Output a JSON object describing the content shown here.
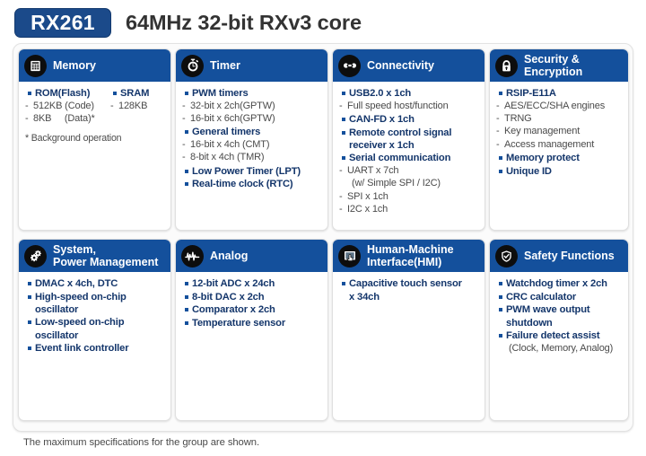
{
  "header": {
    "chip_badge": "RX261",
    "title": "64MHz 32-bit RXv3 core",
    "badge_color": "#1b4a8a",
    "title_color": "#333333"
  },
  "theme": {
    "card_header_blue": "#14509c",
    "bullet_blue": "#14509c",
    "bold_text_blue": "#14366b",
    "sub_text_gray": "#4a4a4a",
    "icon_circle": "#0d0d0d"
  },
  "cards": [
    {
      "id": "memory",
      "title": "Memory",
      "icon": "memory-chip-icon",
      "columns": {
        "left": [
          {
            "kind": "bullet",
            "text": "ROM(Flash)"
          },
          {
            "kind": "sub",
            "mark": "-",
            "text": "512KB (Code)"
          },
          {
            "kind": "sub",
            "mark": "-",
            "text": "8KB     (Data)*"
          }
        ],
        "right": [
          {
            "kind": "bullet",
            "text": "SRAM"
          },
          {
            "kind": "sub",
            "mark": "-",
            "text": "128KB"
          }
        ]
      },
      "note": "* Background operation"
    },
    {
      "id": "timer",
      "title": "Timer",
      "icon": "stopwatch-icon",
      "items": [
        {
          "kind": "bullet",
          "text": "PWM timers"
        },
        {
          "kind": "sub",
          "mark": "-",
          "text": "32-bit x 2ch(GPTW)"
        },
        {
          "kind": "sub",
          "mark": "-",
          "text": "16-bit x 6ch(GPTW)"
        },
        {
          "kind": "bullet",
          "text": "General timers"
        },
        {
          "kind": "sub",
          "mark": "-",
          "text": "16-bit x 4ch (CMT)"
        },
        {
          "kind": "sub",
          "mark": "-",
          "text": "8-bit x 4ch (TMR)"
        },
        {
          "kind": "bullet",
          "text": "Low Power Timer (LPT)"
        },
        {
          "kind": "bullet",
          "text": "Real-time clock (RTC)"
        }
      ]
    },
    {
      "id": "connectivity",
      "title": "Connectivity",
      "icon": "connectivity-link-icon",
      "items": [
        {
          "kind": "bullet",
          "text": "USB2.0 x 1ch"
        },
        {
          "kind": "sub",
          "mark": "-",
          "text": "Full speed host/function"
        },
        {
          "kind": "bullet",
          "text": "CAN-FD x 1ch"
        },
        {
          "kind": "bullet",
          "text": "Remote control signal"
        },
        {
          "kind": "cont",
          "text": "receiver x 1ch"
        },
        {
          "kind": "bullet",
          "text": "Serial communication"
        },
        {
          "kind": "sub",
          "mark": "-",
          "text": "UART x 7ch"
        },
        {
          "kind": "subindent",
          "mark": "-",
          "text": "(w/ Simple SPI / I2C)"
        },
        {
          "kind": "sub",
          "mark": "-",
          "text": "SPI x 1ch"
        },
        {
          "kind": "sub",
          "mark": "-",
          "text": "I2C x 1ch"
        }
      ]
    },
    {
      "id": "security",
      "title": "Security &\nEncryption",
      "icon": "lock-icon",
      "items": [
        {
          "kind": "bullet",
          "text": "RSIP-E11A"
        },
        {
          "kind": "sub",
          "mark": "-",
          "text": "AES/ECC/SHA engines"
        },
        {
          "kind": "sub",
          "mark": "-",
          "text": "TRNG"
        },
        {
          "kind": "sub",
          "mark": "-",
          "text": "Key management"
        },
        {
          "kind": "sub",
          "mark": "-",
          "text": "Access management"
        },
        {
          "kind": "bullet",
          "text": "Memory protect"
        },
        {
          "kind": "bullet",
          "text": "Unique ID"
        }
      ]
    },
    {
      "id": "system-power",
      "title": "System,\nPower Management",
      "icon": "gears-icon",
      "items": [
        {
          "kind": "bullet",
          "text": "DMAC x 4ch, DTC"
        },
        {
          "kind": "bullet",
          "text": "High-speed on-chip"
        },
        {
          "kind": "cont",
          "text": "oscillator"
        },
        {
          "kind": "bullet",
          "text": "Low-speed on-chip"
        },
        {
          "kind": "cont",
          "text": "oscillator"
        },
        {
          "kind": "bullet",
          "text": "Event link controller"
        }
      ]
    },
    {
      "id": "analog",
      "title": "Analog",
      "icon": "waveform-icon",
      "items": [
        {
          "kind": "bullet",
          "text": "12-bit ADC x 24ch"
        },
        {
          "kind": "bullet",
          "text": "8-bit DAC x 2ch"
        },
        {
          "kind": "bullet",
          "text": "Comparator x 2ch"
        },
        {
          "kind": "bullet",
          "text": "Temperature sensor"
        }
      ]
    },
    {
      "id": "hmi",
      "title": "Human-Machine\nInterface(HMI)",
      "icon": "touch-screen-icon",
      "items": [
        {
          "kind": "bullet",
          "text": "Capacitive touch sensor"
        },
        {
          "kind": "cont",
          "text": "x 34ch"
        }
      ]
    },
    {
      "id": "safety",
      "title": "Safety Functions",
      "icon": "shield-check-icon",
      "items": [
        {
          "kind": "bullet",
          "text": "Watchdog timer x 2ch"
        },
        {
          "kind": "bullet",
          "text": "CRC calculator"
        },
        {
          "kind": "bullet",
          "text": "PWM wave output"
        },
        {
          "kind": "cont",
          "text": "shutdown"
        },
        {
          "kind": "bullet",
          "text": "Failure detect assist"
        },
        {
          "kind": "subindent",
          "mark": "",
          "text": "(Clock, Memory, Analog)"
        }
      ]
    }
  ],
  "footer": {
    "note": "The maximum specifications for the group are shown."
  }
}
